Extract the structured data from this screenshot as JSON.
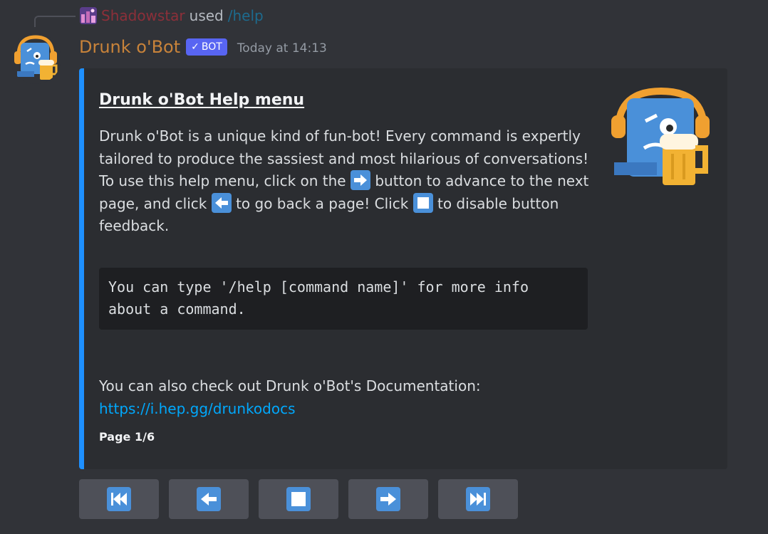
{
  "reply": {
    "username": "Shadowstar",
    "used_text": "used",
    "command": "/help"
  },
  "message": {
    "author": "Drunk o'Bot",
    "badge": "BOT",
    "timestamp": "Today at 14:13"
  },
  "embed": {
    "accent_color": "#1e90ff",
    "title": "Drunk o'Bot Help menu",
    "desc_line1": "Drunk o'Bot is a unique kind of fun-bot! Every command is expertly tailored to produce the sassiest and most hilarious of conversations!",
    "desc_line2_part1": "To use this help menu, click on the",
    "desc_line2_part2": "button to advance to the next page, and click",
    "desc_line2_part3": "to go back a page! Click",
    "desc_line2_part4": "to disable button feedback.",
    "code_text": "You can type '/help [command name]' for more info about a command.",
    "docs_text": "You can also check out Drunk o'Bot's Documentation:",
    "docs_link": "https://i.hep.gg/drunkodocs",
    "footer": "Page 1/6"
  },
  "buttons": [
    {
      "icon": "first-page-icon"
    },
    {
      "icon": "arrow-left-icon"
    },
    {
      "icon": "stop-icon"
    },
    {
      "icon": "arrow-right-icon"
    },
    {
      "icon": "last-page-icon"
    }
  ]
}
